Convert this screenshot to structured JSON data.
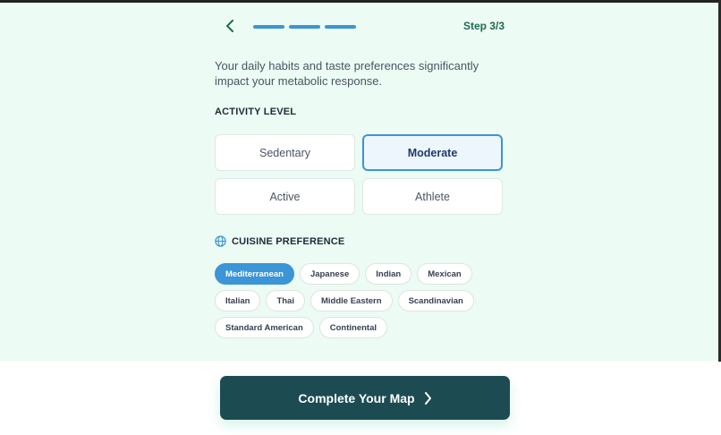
{
  "header": {
    "back_icon": "chevron-left-icon",
    "progress_segments": 3,
    "progress_completed": 3,
    "step_label": "Step 3/3"
  },
  "description": "Your daily habits and taste preferences significantly impact your metabolic response.",
  "activity": {
    "label": "ACTIVITY LEVEL",
    "options": [
      "Sedentary",
      "Moderate",
      "Active",
      "Athlete"
    ],
    "selected": "Moderate"
  },
  "cuisine": {
    "icon": "globe-icon",
    "label": "CUISINE PREFERENCE",
    "options": [
      "Mediterranean",
      "Japanese",
      "Indian",
      "Mexican",
      "Italian",
      "Thai",
      "Middle Eastern",
      "Scandinavian",
      "Standard American",
      "Continental"
    ],
    "selected": "Mediterranean"
  },
  "cta": {
    "label": "Complete Your Map",
    "icon": "chevron-right-icon"
  },
  "colors": {
    "accent": "#3b95d6",
    "cta_bg": "#1d4b52",
    "page_bg": "#ecfbf3"
  }
}
